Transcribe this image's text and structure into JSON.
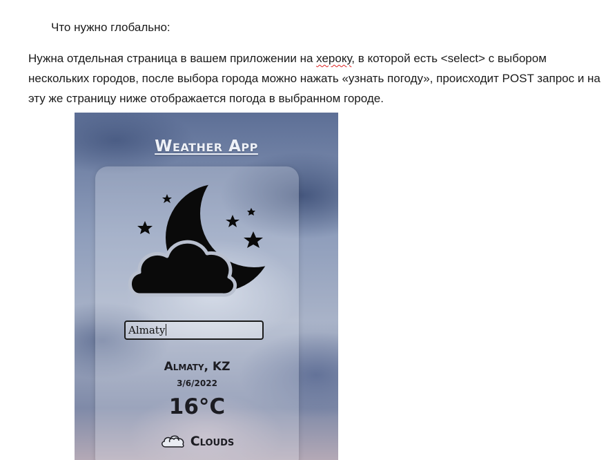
{
  "document": {
    "heading_line": "Что нужно глобально:",
    "paragraph": {
      "before_link": "Нужна отдельная страница в вашем приложении на ",
      "misspelled_word": "хероку",
      "after_link": ", в которой есть <select> с выбором нескольких городов, после выбора города можно нажать «узнать погоду», происходит POST запрос и на эту же страницу ниже отображается погода в выбранном городе."
    }
  },
  "weather_app": {
    "title": "Weather App",
    "icon": "moon-cloud-stars-icon",
    "city_input_value": "Almaty",
    "location": "Almaty, KZ",
    "date": "3/6/2022",
    "temperature": "16°C",
    "condition": "Clouds",
    "condition_icon": "clouds-icon"
  }
}
